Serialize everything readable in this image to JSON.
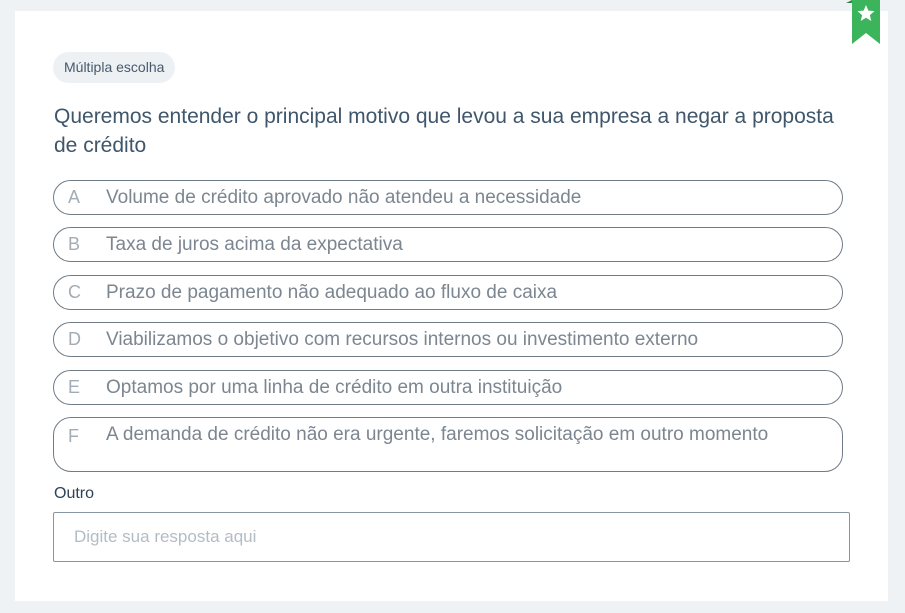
{
  "question": {
    "type_label": "Múltipla escolha",
    "title": "Queremos entender o principal motivo que levou a sua empresa a negar a proposta de crédito"
  },
  "options": [
    {
      "letter": "A",
      "label": "Volume de crédito aprovado não atendeu a necessidade"
    },
    {
      "letter": "B",
      "label": "Taxa de juros acima da expectativa"
    },
    {
      "letter": "C",
      "label": "Prazo de pagamento não adequado ao fluxo de caixa"
    },
    {
      "letter": "D",
      "label": "Viabilizamos o objetivo com recursos internos ou investimento externo"
    },
    {
      "letter": "E",
      "label": "Optamos por uma linha de crédito em outra instituição"
    },
    {
      "letter": "F",
      "label": "A demanda de crédito não era urgente, faremos solicitação em outro momento"
    }
  ],
  "other": {
    "label": "Outro",
    "value": "",
    "placeholder": "Digite sua resposta aqui"
  },
  "bookmark": {
    "icon": "star-icon",
    "color": "#3cb45c"
  },
  "colors": {
    "background": "#eef2f5",
    "card": "#ffffff",
    "question_text": "#3f566b",
    "option_border": "#6f7c88",
    "accent": "#3cb45c"
  }
}
